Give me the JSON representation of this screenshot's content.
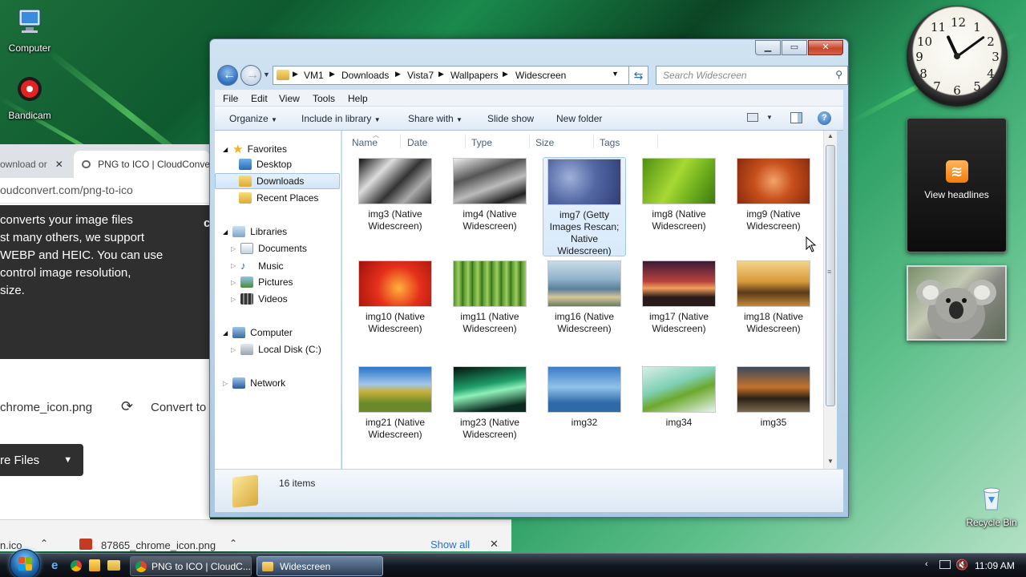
{
  "desktop": {
    "icons": [
      {
        "label": "Computer"
      },
      {
        "label": "Bandicam"
      },
      {
        "label": "Recycle Bin"
      }
    ]
  },
  "chrome": {
    "tab_prev_label": "ownload or",
    "tab_close_glyph": "✕",
    "tab_active_label": "PNG to ICO | CloudConve",
    "url": "oudconvert.com/png-to-ico",
    "hero_lines": [
      "converts your image files",
      "st many others, we support",
      "WEBP and HEIC. You can use",
      "control image resolution,",
      " size."
    ],
    "hero_edge_char": "c",
    "file_name": "chrome_icon.png",
    "convert_label": "Convert to",
    "more_files_label": "re Files",
    "download_bar": {
      "item1_label": "n.ico",
      "item2_label": "87865_chrome_icon.png",
      "show_all_label": "Show all"
    }
  },
  "explorer": {
    "title_buttons": {
      "minimize": "▁",
      "maximize": "▭",
      "close": "✕"
    },
    "breadcrumb": [
      "VM1",
      "Downloads",
      "Vista7",
      "Wallpapers",
      "Widescreen"
    ],
    "search_placeholder": "Search Widescreen",
    "menu": [
      "File",
      "Edit",
      "View",
      "Tools",
      "Help"
    ],
    "commands": [
      "Organize",
      "Include in library",
      "Share with",
      "Slide show",
      "New folder"
    ],
    "nav": {
      "favorites": "Favorites",
      "desktop": "Desktop",
      "downloads": "Downloads",
      "recent_places": "Recent Places",
      "libraries": "Libraries",
      "documents": "Documents",
      "music": "Music",
      "pictures": "Pictures",
      "videos": "Videos",
      "computer": "Computer",
      "local_disk": "Local Disk (C:)",
      "network": "Network"
    },
    "columns": [
      "Name",
      "Date",
      "Type",
      "Size",
      "Tags"
    ],
    "files": [
      {
        "name": "img3 (Native Widescreen)",
        "bg": "linear-gradient(135deg,#111,#ddd 30%,#333 55%,#aaa 75%,#222)"
      },
      {
        "name": "img4 (Native Widescreen)",
        "bg": "linear-gradient(160deg,#eee,#555 35%,#bbb 60%,#222 85%,#999)"
      },
      {
        "name": "img7 (Getty Images Rescan; Native Widescreen)",
        "bg": "radial-gradient(circle at 30% 40%,#9fb0d8,#5468a5 45%,#2f3e74)"
      },
      {
        "name": "img8 (Native Widescreen)",
        "bg": "linear-gradient(120deg,#4f8f12,#a7d834 45%,#6fb01e 70%,#3d7a0e)"
      },
      {
        "name": "img9 (Native Widescreen)",
        "bg": "radial-gradient(circle at 50% 50%,#f3a36a,#c7501c 45%,#8a2b0c)"
      },
      {
        "name": "img10 (Native Widescreen)",
        "bg": "radial-gradient(circle at 55% 60%,#ffb13b,#e5301b 45%,#a1120b)"
      },
      {
        "name": "img11 (Native Widescreen)",
        "bg": "repeating-linear-gradient(90deg,#4f8f2a 0,#9ed05f 6px,#2f6a18 12px)"
      },
      {
        "name": "img16 (Native Widescreen)",
        "bg": "linear-gradient(180deg,#c9dbe8,#8fb2c9 40%,#5a7f96 62%,#d7c69b 80%,#6a7d5a)"
      },
      {
        "name": "img17 (Native Widescreen)",
        "bg": "linear-gradient(180deg,#3a1a34,#b8423e 45%,#f2a05a 60%,#2a1a1a 80%)"
      },
      {
        "name": "img18 (Native Widescreen)",
        "bg": "linear-gradient(180deg,#f2d48a,#d99a3a 45%,#5a3a1a 70%,#c38a3a)"
      },
      {
        "name": "img21 (Native Widescreen)",
        "bg": "linear-gradient(180deg,#2b74c9,#9fc6ea 38%,#c9b03a 55%,#6a8a2a 80%)"
      },
      {
        "name": "img23 (Native Widescreen)",
        "bg": "linear-gradient(170deg,#04120c,#1e9d6a 40%,#8ef0b8 55%,#0a2a1f 85%)"
      },
      {
        "name": "img32",
        "bg": "linear-gradient(180deg,#3a7cc6,#8fc3ea 45%,#2f6aa8 80%)"
      },
      {
        "name": "img34",
        "bg": "linear-gradient(160deg,#d8efe8,#7fd0b4 40%,#6ca82c 60%,#e6f4ee)"
      },
      {
        "name": "img35",
        "bg": "linear-gradient(180deg,#3b4a5c,#c4722c 45%,#2a2016 70%,#7a6a50)"
      }
    ],
    "status": "16 items"
  },
  "gadgets": {
    "clock_numbers": [
      "12",
      "1",
      "2",
      "3",
      "4",
      "5",
      "6",
      "7",
      "8",
      "9",
      "10",
      "11"
    ],
    "feed_label": "View headlines",
    "rss_glyph": "≋"
  },
  "taskbar": {
    "items": [
      {
        "label": "PNG to ICO | CloudC..."
      },
      {
        "label": "Widescreen"
      }
    ],
    "time": "11:09 AM"
  }
}
